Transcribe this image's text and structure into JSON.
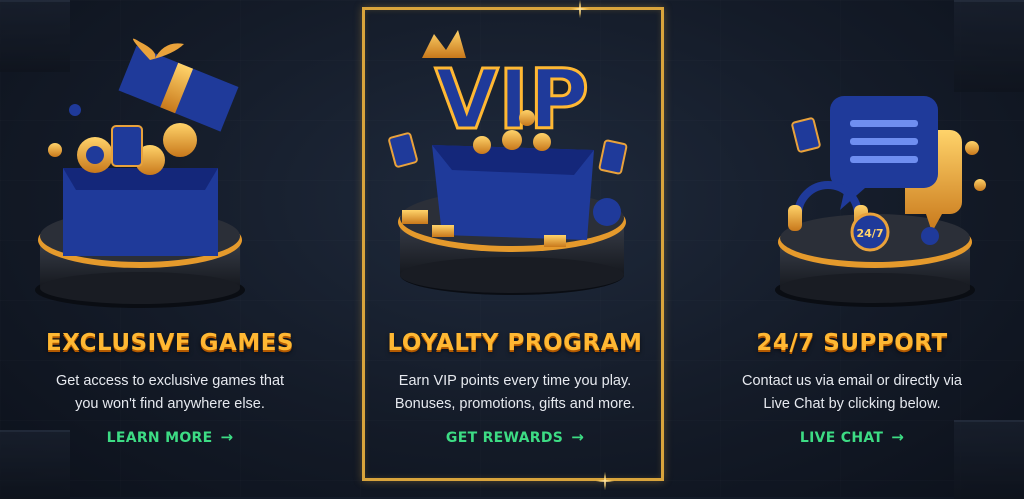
{
  "features": [
    {
      "title": "EXCLUSIVE GAMES",
      "description_lines": [
        "Get access to exclusive games that",
        "you won't find anywhere else."
      ],
      "link_label": "LEARN MORE",
      "illustration": "gift-box-icon"
    },
    {
      "title": "LOYALTY PROGRAM",
      "description_lines": [
        "Earn VIP points every time you play.",
        "Bonuses, promotions, gifts and more."
      ],
      "link_label": "GET REWARDS",
      "illustration_text": "VIP",
      "illustration": "vip-chest-icon"
    },
    {
      "title": "24/7 SUPPORT",
      "description_lines": [
        "Contact us via email or directly via",
        "Live Chat by clicking below."
      ],
      "link_label": "LIVE CHAT",
      "illustration_text": "24/7",
      "illustration": "chat-support-icon"
    }
  ],
  "arrow_glyph": "→",
  "colors": {
    "title_orange": "#ffb833",
    "link_green": "#3ddc84",
    "royal_blue": "#1f3a9a",
    "gold": "#e9a23b",
    "frame_gold": "#d9a43c"
  }
}
